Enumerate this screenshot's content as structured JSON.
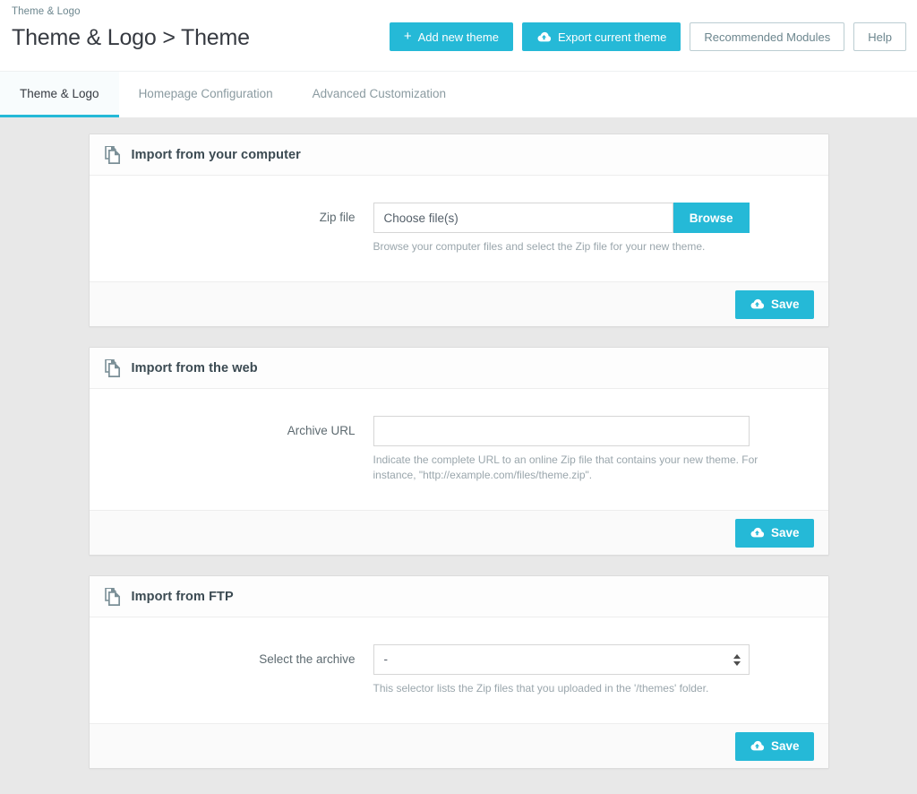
{
  "colors": {
    "accent": "#25b9d7",
    "page_bg": "#e8e8e8",
    "panel_bg": "#ffffff",
    "footer_bg": "#fafafa",
    "title_text": "#363a41",
    "muted_text": "#9aa6ac"
  },
  "header": {
    "breadcrumb": "Theme & Logo",
    "title": "Theme & Logo > Theme",
    "actions": {
      "add_new_theme": "Add new theme",
      "add_new_theme_icon": "plus-icon",
      "export_current_theme": "Export current theme",
      "export_current_theme_icon": "cloud-upload-icon",
      "recommended_modules": "Recommended Modules",
      "help": "Help"
    }
  },
  "tabs": [
    {
      "label": "Theme & Logo",
      "active": true
    },
    {
      "label": "Homepage Configuration",
      "active": false
    },
    {
      "label": "Advanced Customization",
      "active": false
    }
  ],
  "panels": [
    {
      "id": "import-from-your-computer",
      "title": "Import from your computer",
      "icon": "document-copy-icon",
      "field": {
        "label": "Zip file",
        "type": "file",
        "placeholder": "Choose file(s)",
        "value": "",
        "button_label": "Browse",
        "help": "Browse your computer files and select the Zip file for your new theme."
      },
      "save_label": "Save",
      "save_icon": "cloud-upload-icon"
    },
    {
      "id": "import-from-the-web",
      "title": "Import from the web",
      "icon": "document-copy-icon",
      "field": {
        "label": "Archive URL",
        "type": "text",
        "placeholder": "",
        "value": "",
        "help": "Indicate the complete URL to an online Zip file that contains your new theme. For instance, \"http://example.com/files/theme.zip\"."
      },
      "save_label": "Save",
      "save_icon": "cloud-upload-icon"
    },
    {
      "id": "import-from-ftp",
      "title": "Import from FTP",
      "icon": "document-copy-icon",
      "field": {
        "label": "Select the archive",
        "type": "select",
        "value": "-",
        "options": [
          "-"
        ],
        "help": "This selector lists the Zip files that you uploaded in the '/themes' folder."
      },
      "save_label": "Save",
      "save_icon": "cloud-upload-icon"
    }
  ]
}
